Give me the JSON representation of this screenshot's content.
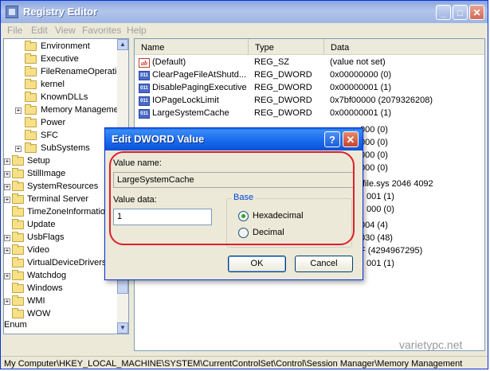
{
  "window": {
    "title": "Registry Editor",
    "minimize_glyph": "_",
    "maximize_glyph": "□",
    "close_glyph": "✕"
  },
  "menu": [
    "File",
    "Edit",
    "View",
    "Favorites",
    "Help"
  ],
  "tree": {
    "items": [
      {
        "label": "Environment",
        "expand": ""
      },
      {
        "label": "Executive",
        "expand": ""
      },
      {
        "label": "FileRenameOperatio",
        "expand": ""
      },
      {
        "label": "kernel",
        "expand": ""
      },
      {
        "label": "KnownDLLs",
        "expand": ""
      },
      {
        "label": "Memory Manageme",
        "expand": "+"
      },
      {
        "label": "Power",
        "expand": ""
      },
      {
        "label": "SFC",
        "expand": ""
      },
      {
        "label": "SubSystems",
        "expand": "+"
      }
    ],
    "level2": [
      {
        "label": "Setup",
        "expand": "+"
      },
      {
        "label": "StillImage",
        "expand": "+"
      },
      {
        "label": "SystemResources",
        "expand": "+"
      },
      {
        "label": "Terminal Server",
        "expand": "+"
      },
      {
        "label": "TimeZoneInformation",
        "expand": ""
      },
      {
        "label": "Update",
        "expand": ""
      },
      {
        "label": "UsbFlags",
        "expand": "+"
      },
      {
        "label": "Video",
        "expand": "+"
      },
      {
        "label": "VirtualDeviceDrivers",
        "expand": ""
      },
      {
        "label": "Watchdog",
        "expand": "+"
      },
      {
        "label": "Windows",
        "expand": ""
      },
      {
        "label": "WMI",
        "expand": "+"
      },
      {
        "label": "WOW",
        "expand": ""
      }
    ],
    "enum_label": "Enum"
  },
  "list": {
    "headers": {
      "name": "Name",
      "type": "Type",
      "data": "Data"
    },
    "rows": [
      {
        "icon": "ab",
        "name": "(Default)",
        "type": "REG_SZ",
        "data": "(value not set)"
      },
      {
        "icon": "011",
        "name": "ClearPageFileAtShutd...",
        "type": "REG_DWORD",
        "data": "0x00000000 (0)"
      },
      {
        "icon": "011",
        "name": "DisablePagingExecutive",
        "type": "REG_DWORD",
        "data": "0x00000001 (1)"
      },
      {
        "icon": "011",
        "name": "IOPageLockLimit",
        "type": "REG_DWORD",
        "data": "0x7bf00000 (2079326208)"
      },
      {
        "icon": "011",
        "name": "LargeSystemCache",
        "type": "REG_DWORD",
        "data": "0x00000001 (1)"
      }
    ],
    "partial_data": [
      "000 (0)",
      "000 (0)",
      "000 (0)",
      "000 (0)",
      "file.sys 2046 4092",
      "001 (1)",
      "000 (0)",
      "004 (4)",
      "030 (48)",
      "F (4294967295)",
      "001 (1)"
    ]
  },
  "dialog": {
    "title": "Edit DWORD Value",
    "help_glyph": "?",
    "close_glyph": "✕",
    "value_name_label": "Value name:",
    "value_name": "LargeSystemCache",
    "value_data_label": "Value data:",
    "value_data": "1",
    "base_label": "Base",
    "hex_label": "Hexadecimal",
    "dec_label": "Decimal",
    "ok_label": "OK",
    "cancel_label": "Cancel"
  },
  "statusbar": {
    "path": "My Computer\\HKEY_LOCAL_MACHINE\\SYSTEM\\CurrentControlSet\\Control\\Session Manager\\Memory Management"
  },
  "watermark": "varietypc.net",
  "colors": {
    "highlight_ring": "#e01e2a",
    "dialog_title": "#1d6ef0"
  }
}
